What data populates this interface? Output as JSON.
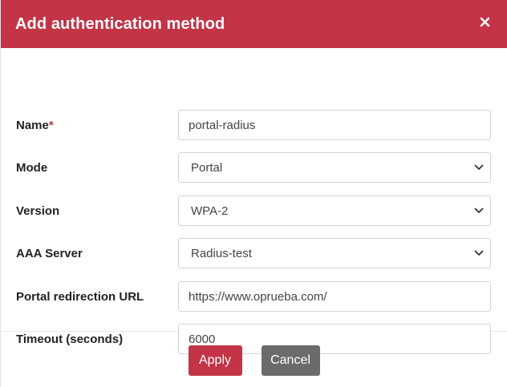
{
  "dialog": {
    "title": "Add authentication method",
    "close_icon": "close-icon"
  },
  "form": {
    "name": {
      "label": "Name",
      "required_marker": "*",
      "value": "portal-radius"
    },
    "mode": {
      "label": "Mode",
      "value": "Portal"
    },
    "version": {
      "label": "Version",
      "value": "WPA-2"
    },
    "aaa_server": {
      "label": "AAA Server",
      "value": "Radius-test"
    },
    "portal_url": {
      "label": "Portal redirection URL",
      "value": "https://www.oprueba.com/"
    },
    "timeout": {
      "label": "Timeout (seconds)",
      "value": "6000"
    }
  },
  "footer": {
    "apply_label": "Apply",
    "cancel_label": "Cancel"
  },
  "colors": {
    "brand": "#c23446",
    "cancel": "#6b6b6b"
  }
}
